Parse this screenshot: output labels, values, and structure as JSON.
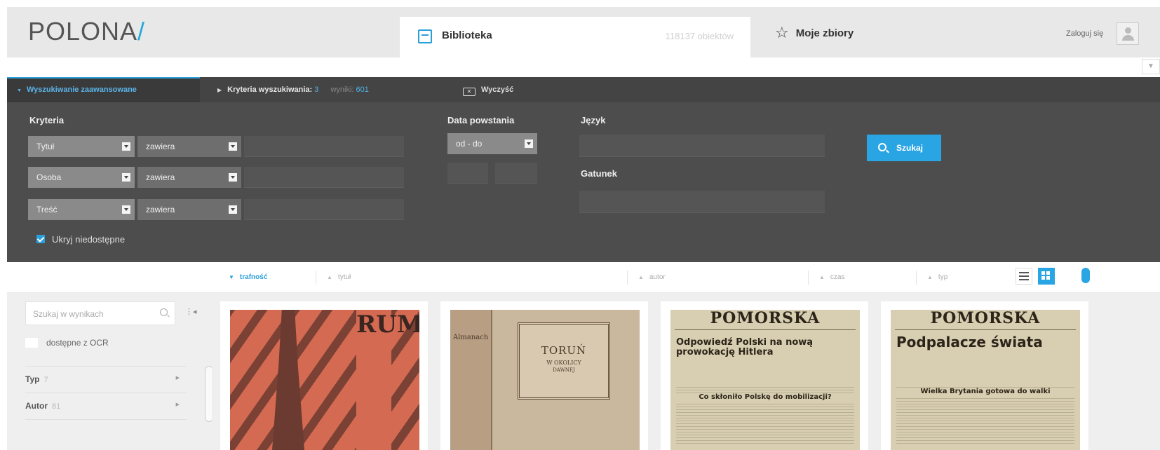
{
  "header": {
    "logo_text": "POLONA",
    "logo_slash": "/",
    "library_tab": "Biblioteka",
    "object_count": "118137 obiektów",
    "my_collections_tab": "Moje zbiory",
    "login": "Zaloguj się"
  },
  "search_tabs": {
    "advanced": "Wyszukiwanie zaawansowane",
    "criteria_label": "Kryteria wyszukiwania:",
    "criteria_count": "3",
    "results_label": "wyniki:",
    "results_count": "601",
    "clear": "Wyczyść"
  },
  "panel": {
    "criteria_heading": "Kryteria",
    "rows": [
      {
        "field": "Tytuł",
        "operator": "zawiera",
        "value": ""
      },
      {
        "field": "Osoba",
        "operator": "zawiera",
        "value": ""
      },
      {
        "field": "Treść",
        "operator": "zawiera",
        "value": ""
      }
    ],
    "hide_unavailable": "Ukryj niedostępne",
    "date_heading": "Data powstania",
    "date_mode": "od - do",
    "language_heading": "Język",
    "genre_heading": "Gatunek",
    "search_button": "Szukaj"
  },
  "sort": {
    "relevance": "trafność",
    "title": "tytuł",
    "author": "autor",
    "date": "czas",
    "type": "typ"
  },
  "sidebar": {
    "search_placeholder": "Szukaj w wynikach",
    "ocr_filter": "dostępne z OCR",
    "facets": [
      {
        "label": "Typ",
        "count": "7"
      },
      {
        "label": "Autor",
        "count": "81"
      }
    ]
  },
  "results": [
    {
      "kind": "poster",
      "text": "RUM"
    },
    {
      "kind": "book",
      "spine": "Almanach",
      "title": "TORUŃ",
      "subtitle": "W OKOLICY",
      "line3": "DAWNEJ"
    },
    {
      "kind": "newspaper",
      "masthead": "POMORSKA",
      "headline": "Odpowiedź Polski na nową prowokację Hitlera",
      "subhead": "Co skłoniło Polskę do mobilizacji?"
    },
    {
      "kind": "newspaper",
      "masthead": "POMORSKA",
      "headline": "Podpalacze świata",
      "subhead": "Wielka Brytania gotowa do walki"
    }
  ],
  "colors": {
    "accent": "#2aa5e3",
    "panel_bg": "#4d4d4d",
    "header_bg": "#e8e8e8"
  },
  "icons": {
    "library": "archive-box-icon",
    "favorites": "star-icon",
    "user": "user-icon",
    "clear": "backspace-icon",
    "search": "search-icon",
    "view_list": "list-view-icon",
    "view_grid": "grid-view-icon",
    "scroll": "mouse-icon"
  }
}
